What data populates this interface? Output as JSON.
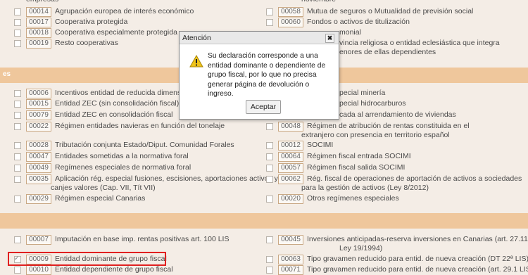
{
  "top_section": {
    "left": [
      {
        "code": "",
        "label": "empresas"
      },
      {
        "code": "00014",
        "label": "Agrupación europea de interés económico"
      },
      {
        "code": "00017",
        "label": "Cooperativa protegida"
      },
      {
        "code": "00018",
        "label": "Cooperativa especialmente protegida"
      },
      {
        "code": "00019",
        "label": "Resto cooperativas"
      }
    ],
    "right": [
      {
        "code": "",
        "label": "noviembre"
      },
      {
        "code": "00058",
        "label": "Mutua de seguros o Mutualidad de previsión social"
      },
      {
        "code": "00060",
        "label": "Fondos o activos de titulización"
      },
      {
        "code": "",
        "label": "monial"
      },
      {
        "label": "vincia religiosa o entidad eclesiástica que integra"
      },
      {
        "label": "enores de ellas dependientes"
      }
    ]
  },
  "band1": {
    "label": "es"
  },
  "middle_section": {
    "left": [
      {
        "code": "00006",
        "label": "Incentivos entidad de reducida dimensión (art. 101 LIS)"
      },
      {
        "code": "00015",
        "label": "Entidad ZEC (sin consolidación fiscal)"
      },
      {
        "code": "00079",
        "label": "Entidad ZEC en consolidación fiscal"
      },
      {
        "code": "00022",
        "label": "Régimen entidades navieras en función del tonelaje"
      },
      {
        "code": "00028",
        "label": "Tributación conjunta Estado/Diput. Comunidad Forales"
      },
      {
        "code": "00047",
        "label": "Entidades sometidas a la normativa foral"
      },
      {
        "code": "00049",
        "label": "Regímenes especiales de normativa foral"
      },
      {
        "code": "00035",
        "label": "Aplicación rég. especial fusiones, escisiones, aportaciones activos y"
      },
      {
        "label": "canjes valores (Cap. VII, Tít VII)"
      },
      {
        "code": "00029",
        "label": "Régimen especial Canarias"
      }
    ],
    "right": [
      {
        "label": "pecial minería"
      },
      {
        "label": "pecial hidrocarburos"
      },
      {
        "label": "cada al arrendamiento de viviendas"
      },
      {
        "code": "00048",
        "label": "Régimen de atribución de rentas constituida en el"
      },
      {
        "label": "extranjero con presencia en territorio español"
      },
      {
        "code": "00012",
        "label": "SOCIMI"
      },
      {
        "code": "00064",
        "label": "Régimen fiscal entrada SOCIMI"
      },
      {
        "code": "00057",
        "label": "Régimen fiscal salida SOCIMI"
      },
      {
        "code": "00062",
        "label": "Rég. fiscal de operaciones de aportación de activos a sociedades"
      },
      {
        "label": "para la gestión de activos (Ley 8/2012)"
      },
      {
        "code": "00020",
        "label": "Otros regímenes especiales"
      }
    ]
  },
  "bottom_section": {
    "left": [
      {
        "code": "00007",
        "label": "Imputación en base imp. rentas positivas art. 100 LIS"
      },
      {
        "code": "00009",
        "label": "Entidad dominante de grupo fiscal",
        "checked": true
      },
      {
        "code": "00010",
        "label": "Entidad dependiente de grupo fiscal"
      }
    ],
    "right": [
      {
        "code": "00045",
        "label": "Inversiones anticipadas-reserva inversiones en Canarias (art. 27.11"
      },
      {
        "label": "Ley 19/1994)"
      },
      {
        "code": "00063",
        "label": "Tipo gravamen reducido para entid. de nueva creación (DT 22ª LIS)"
      },
      {
        "code": "00071",
        "label": "Tipo gravamen reducido para entid. de nueva creación (art. 29.1 LIS)"
      }
    ]
  },
  "dialog": {
    "title": "Atención",
    "close": "✖",
    "message": "Su declaración corresponde a una\nentidad dominante o dependiente de\ngrupo fiscal, por lo que no precisa\ngenerar página de devolución o ingreso.",
    "button": "Aceptar"
  },
  "colors": {
    "accent_band": "#efc79c",
    "highlight": "#e02020",
    "warning_icon": "#f0c419"
  }
}
